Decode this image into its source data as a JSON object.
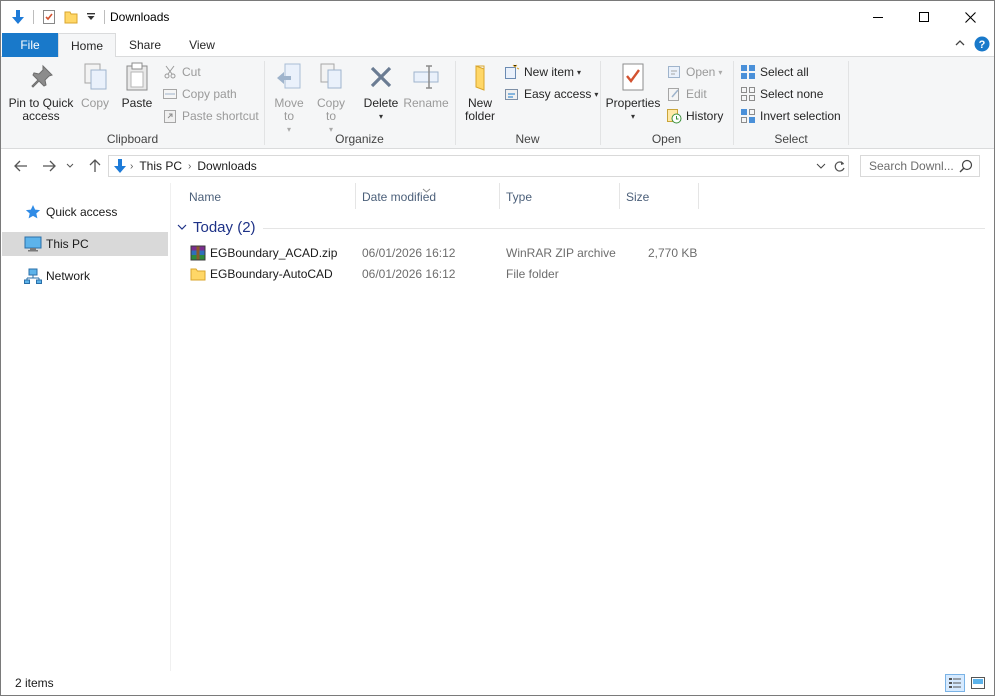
{
  "window": {
    "title": "Downloads"
  },
  "tabs": {
    "file": "File",
    "home": "Home",
    "share": "Share",
    "view": "View"
  },
  "ribbon": {
    "clipboard": {
      "label": "Clipboard",
      "pin": "Pin to Quick access",
      "copy": "Copy",
      "paste": "Paste",
      "cut": "Cut",
      "copy_path": "Copy path",
      "paste_shortcut": "Paste shortcut"
    },
    "organize": {
      "label": "Organize",
      "move_to": "Move to",
      "copy_to": "Copy to",
      "delete": "Delete",
      "rename": "Rename"
    },
    "new": {
      "label": "New",
      "new_folder": "New folder",
      "new_item": "New item",
      "easy_access": "Easy access"
    },
    "open": {
      "label": "Open",
      "properties": "Properties",
      "open": "Open",
      "edit": "Edit",
      "history": "History"
    },
    "select": {
      "label": "Select",
      "select_all": "Select all",
      "select_none": "Select none",
      "invert_selection": "Invert selection"
    }
  },
  "address": {
    "crumbs": [
      "This PC",
      "Downloads"
    ],
    "search_placeholder": "Search Downl..."
  },
  "navpane": {
    "items": [
      {
        "label": "Quick access",
        "icon": "star-icon",
        "selected": false
      },
      {
        "label": "This PC",
        "icon": "computer-icon",
        "selected": true
      },
      {
        "label": "Network",
        "icon": "network-icon",
        "selected": false
      }
    ]
  },
  "columns": {
    "name": "Name",
    "date": "Date modified",
    "type": "Type",
    "size": "Size"
  },
  "groups": [
    {
      "title": "Today (2)",
      "files": [
        {
          "name": "EGBoundary_ACAD.zip",
          "date": "06/01/2026 16:12",
          "type": "WinRAR ZIP archive",
          "size": "2,770 KB",
          "icon": "winrar-icon"
        },
        {
          "name": "EGBoundary-AutoCAD",
          "date": "06/01/2026 16:12",
          "type": "File folder",
          "size": "",
          "icon": "folder-icon"
        }
      ]
    }
  ],
  "status": {
    "count": "2 items"
  },
  "colors": {
    "accent": "#1979ca",
    "selected_nav": "#d9d9d9",
    "group_header": "#1e3287"
  }
}
